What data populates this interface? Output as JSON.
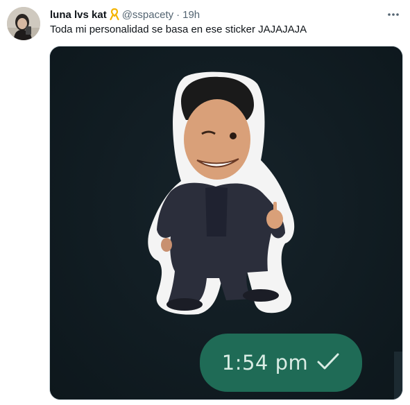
{
  "user": {
    "display_name": "luna lvs kat",
    "handle": "@sspacety",
    "separator": "·",
    "time": "19h"
  },
  "tweet": {
    "text": "Toda mi personalidad se basa en ese sticker JAJAJAJA"
  },
  "media": {
    "message_time": "1:54 pm",
    "bubble_color": "#1f6b56",
    "background_color": "#101b21"
  },
  "icons": {
    "badge": "yellow-ribbon-icon",
    "more": "more-options-icon",
    "check": "checkmark-icon"
  }
}
